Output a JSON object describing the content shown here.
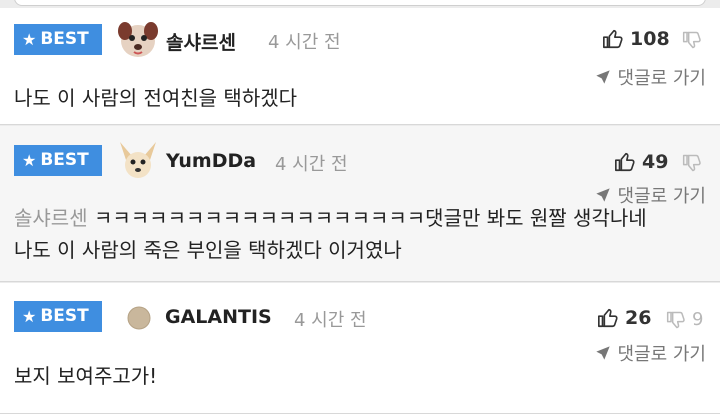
{
  "badge_label": "BEST",
  "reply_label": "댓글로 가기",
  "comments": [
    {
      "nickname": "솔샤르센",
      "time": "4 시간 전",
      "likes": "108",
      "dislikes": "",
      "text": "나도 이 사람의 전여친을 택하겠다"
    },
    {
      "nickname": "YumDDa",
      "time": "4 시간 전",
      "likes": "49",
      "dislikes": "",
      "quote_author": "솔샤르센",
      "text_line1": "ㅋㅋㅋㅋㅋㅋㅋㅋㅋㅋㅋㅋㅋㅋㅋㅋㅋㅋ댓글만 봐도 원짤 생각나네",
      "text_line2": "나도 이 사람의 죽은 부인을 택하겠다 이거였나"
    },
    {
      "nickname": "GALANTIS",
      "time": "4 시간 전",
      "likes": "26",
      "dislikes": "9",
      "text": "보지 보여주고가!"
    }
  ],
  "colors": {
    "badge": "#3f8ee0",
    "muted": "#999999"
  }
}
